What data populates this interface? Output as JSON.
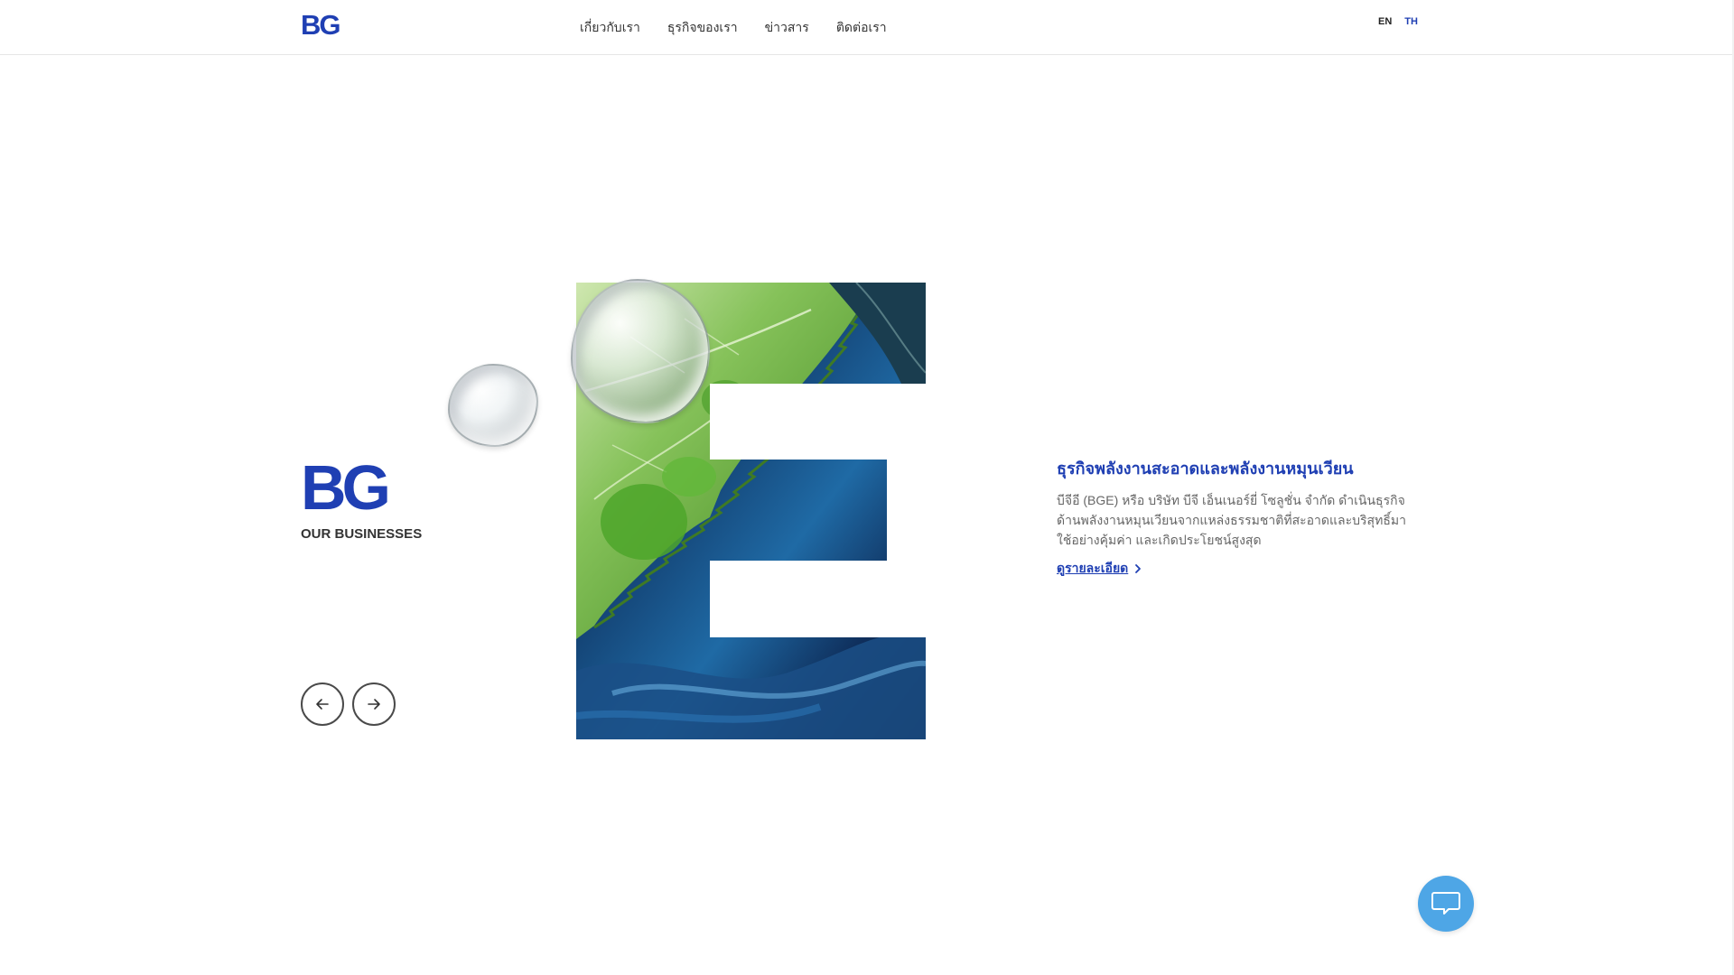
{
  "header": {
    "logo_text": "BG",
    "nav": [
      {
        "label": "เกี่ยวกับเรา"
      },
      {
        "label": "ธุรกิจของเรา"
      },
      {
        "label": "ข่าวสาร"
      },
      {
        "label": "ติดต่อเรา"
      }
    ],
    "lang": {
      "en": "EN",
      "th": "TH"
    }
  },
  "brand": {
    "logo_text": "BG",
    "subtitle": "OUR BUSINESSES"
  },
  "slide": {
    "title": "ธุรกิจพลังงานสะอาดและพลังงานหมุนเวียน",
    "description": "บีจีอี (BGE) หรือ บริษัท บีจี เอ็นเนอร์ยี่ โซลูชั่น จำกัด ดำเนินธุรกิจด้านพลังงานหมุนเวียนจากแหล่งธรรมชาติที่สะอาดและบริสุทธิ์มาใช้อย่างคุ้มค่า และเกิดประโยชน์สูงสุด",
    "more_label": "ดูรายละเอียด"
  },
  "icons": {
    "prev": "arrow-left-icon",
    "next": "arrow-right-icon",
    "more": "chevron-right-icon",
    "chat": "chat-bubble-icon"
  },
  "colors": {
    "brand_blue": "#1f3fb3",
    "chat_blue": "#4ea6e6"
  }
}
